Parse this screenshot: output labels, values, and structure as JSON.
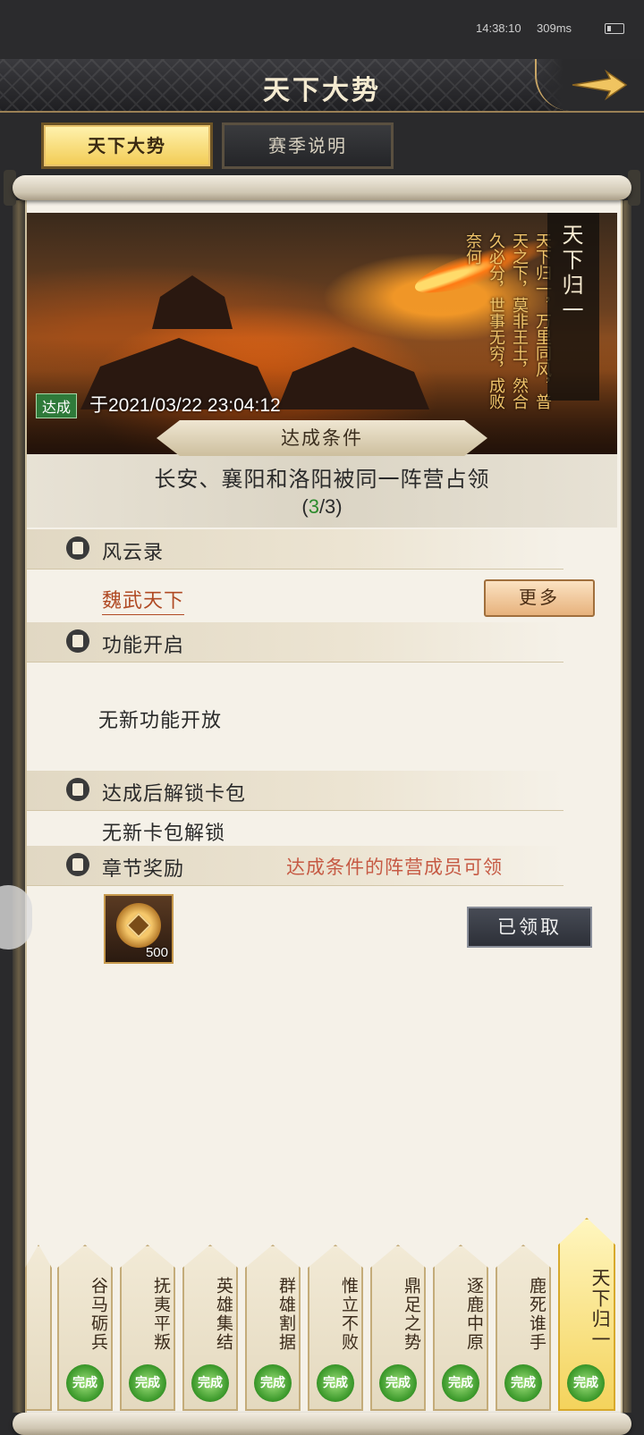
{
  "status": {
    "time": "14:38:10",
    "network": "309ms"
  },
  "header": {
    "title": "天下大势"
  },
  "tabs": [
    {
      "label": "天下大势",
      "active": true
    },
    {
      "label": "赛季说明",
      "active": false
    }
  ],
  "banner": {
    "chapter_title": "天下归一",
    "poem": "天下归一，万里同风，普天之下，莫非王土，然合久必分，世事无穷，成败奈何",
    "achieved_tag": "达成",
    "achieved_time": "于2021/03/22 23:04:12"
  },
  "condition": {
    "title": "达成条件",
    "text": "长安、襄阳和洛阳被同一阵营占领",
    "progress_open": "(",
    "progress_current": "3",
    "progress_rest": "/3)"
  },
  "sections": {
    "records": {
      "label": "风云录",
      "link": "魏武天下",
      "more": "更多"
    },
    "features": {
      "label": "功能开启",
      "text": "无新功能开放"
    },
    "cardpack": {
      "label": "达成后解锁卡包",
      "text": "无新卡包解锁"
    },
    "reward": {
      "label": "章节奖励",
      "note": "达成条件的阵营成员可领",
      "item_qty": "500",
      "claimed": "已领取"
    }
  },
  "chapter_tabs": [
    {
      "name": "谷马砺兵",
      "done": "完成"
    },
    {
      "name": "抚夷平叛",
      "done": "完成"
    },
    {
      "name": "英雄集结",
      "done": "完成"
    },
    {
      "name": "群雄割据",
      "done": "完成"
    },
    {
      "name": "惟立不败",
      "done": "完成"
    },
    {
      "name": "鼎足之势",
      "done": "完成"
    },
    {
      "name": "逐鹿中原",
      "done": "完成"
    },
    {
      "name": "鹿死谁手",
      "done": "完成"
    },
    {
      "name": "天下归一",
      "done": "完成",
      "active": true
    }
  ],
  "colors": {
    "accent_gold": "#f2cb53",
    "highlight_red": "#b04a24",
    "progress_green": "#2c8a2c"
  }
}
